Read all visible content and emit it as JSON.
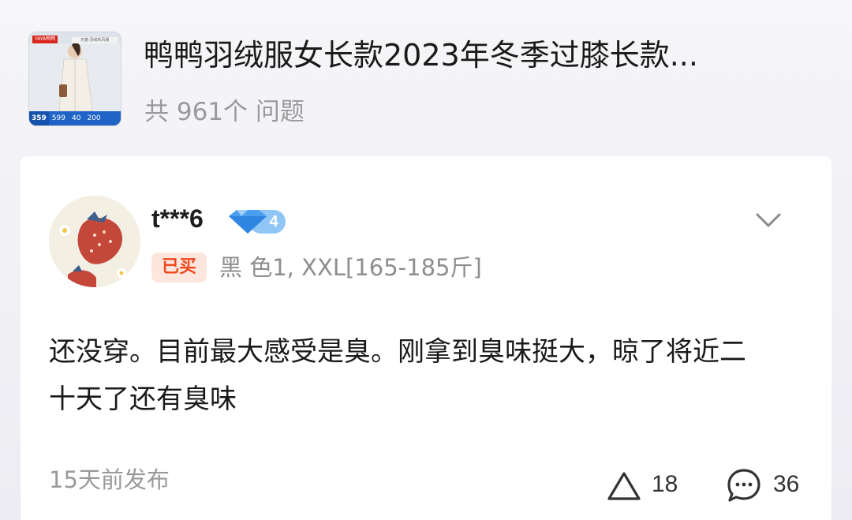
{
  "product": {
    "title": "鸭鸭羽绒服女长款2023年冬季过膝长款...",
    "question_count": "共 961个 问题",
    "thumbnail": {
      "brand": "YAYA鸭鸭",
      "tag": "天猫·羽绒新风潮",
      "prices": [
        "359",
        "599",
        "40",
        "200"
      ]
    }
  },
  "question": {
    "username": "t***6",
    "level": "4",
    "purchased_badge": "已买",
    "sku": "黑 色1, XXL[165-185斤]",
    "text": "还没穿。目前最大感受是臭。刚拿到臭味挺大，晾了将近二十天了还有臭味",
    "posted": "15天前发布",
    "likes": "18",
    "comments": "36"
  },
  "icons": {
    "more": "chevron-down-icon",
    "like": "triangle-up-icon",
    "comment": "chat-bubble-icon",
    "level": "diamond-icon"
  },
  "colors": {
    "purchased_text": "#f0481c",
    "purchased_bg": "#fde6de",
    "level_badge": "#5aa9f0",
    "muted_text": "#9a9a9a"
  }
}
